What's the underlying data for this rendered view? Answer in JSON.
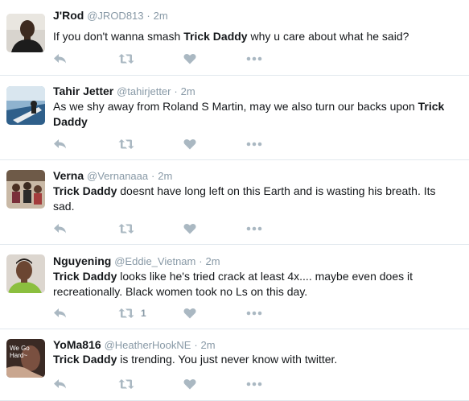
{
  "tweets": [
    {
      "name": "J'Rod",
      "handle": "@JROD813",
      "separator": "·",
      "time": "2m",
      "text_before": "If you don't wanna smash ",
      "bold": "Trick Daddy",
      "text_after": " why u care about what he said?",
      "retweet_count": "",
      "avatar": "avatar-man-dark-shirt"
    },
    {
      "name": "Tahir Jetter",
      "handle": "@tahirjetter",
      "separator": "·",
      "time": "2m",
      "text_before": "As we shy away from Roland S Martin, may we also turn our backs upon ",
      "bold": "Trick Daddy",
      "text_after": "",
      "retweet_count": "",
      "avatar": "avatar-boat-water"
    },
    {
      "name": "Verna",
      "handle": "@Vernanaaa",
      "separator": "·",
      "time": "2m",
      "text_before": "",
      "bold": "Trick Daddy",
      "text_after": " doesnt have long left on this Earth and is wasting his breath. Its sad.",
      "retweet_count": "",
      "avatar": "avatar-group-photo"
    },
    {
      "name": "Nguyening",
      "handle": "@Eddie_Vietnam",
      "separator": "·",
      "time": "2m",
      "text_before": "",
      "bold": "Trick Daddy",
      "text_after": " looks like he's tried crack at least 4x.... maybe even does it recreationally.  Black women took no Ls on this day.",
      "retweet_count": "1",
      "avatar": "avatar-person-green"
    },
    {
      "name": "YoMa816",
      "handle": "@HeatherHookNE",
      "separator": "·",
      "time": "2m",
      "text_before": "",
      "bold": "Trick Daddy",
      "text_after": " is trending. You just never know with twitter.",
      "retweet_count": "",
      "avatar": "avatar-we-go-hard",
      "avatar_text_1": "We Go",
      "avatar_text_2": "Hard~"
    }
  ],
  "colors": {
    "name": "#14171a",
    "meta": "#8899a6",
    "action_icon": "#aab8c2",
    "separator": "#e1e8ed"
  },
  "icons": [
    "reply-icon",
    "retweet-icon",
    "like-icon",
    "more-icon"
  ]
}
